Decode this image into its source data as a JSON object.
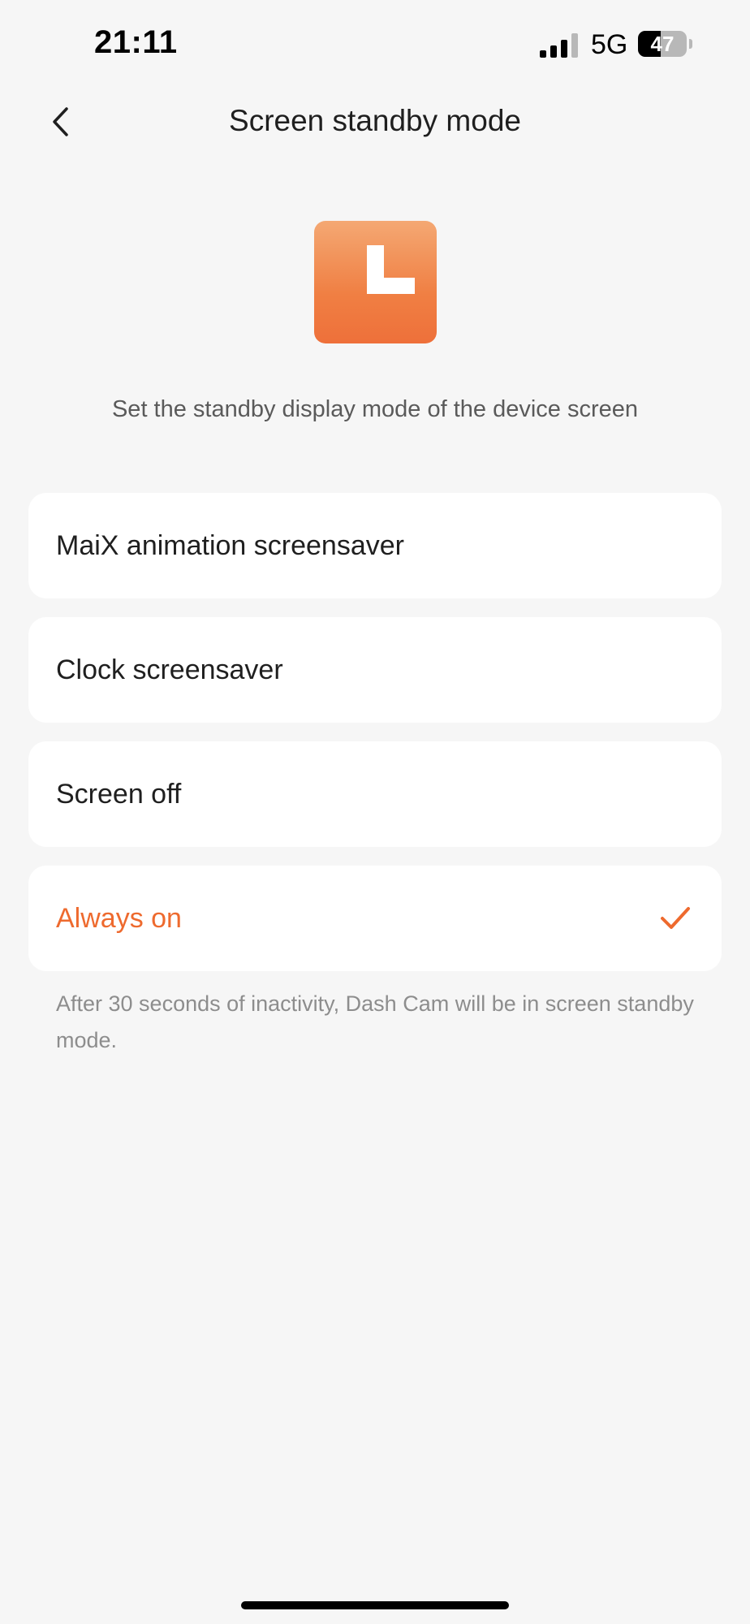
{
  "status_bar": {
    "time": "21:11",
    "network": "5G",
    "battery_level": "47",
    "battery_fraction": 0.47
  },
  "nav": {
    "title": "Screen standby mode",
    "back_icon": "chevron-left-icon"
  },
  "hero": {
    "icon": "clock-icon",
    "gradient_top": "#f4a873",
    "gradient_bottom": "#ee703a"
  },
  "subtitle": "Set the standby display mode of the device screen",
  "options": [
    {
      "label": "MaiX animation screensaver",
      "selected": false
    },
    {
      "label": "Clock screensaver",
      "selected": false
    },
    {
      "label": "Screen off",
      "selected": false
    },
    {
      "label": "Always on",
      "selected": true
    }
  ],
  "check_icon": "checkmark-icon",
  "accent_color": "#ee6a2e",
  "footnote": "After 30 seconds of inactivity, Dash Cam will be in screen standby mode."
}
